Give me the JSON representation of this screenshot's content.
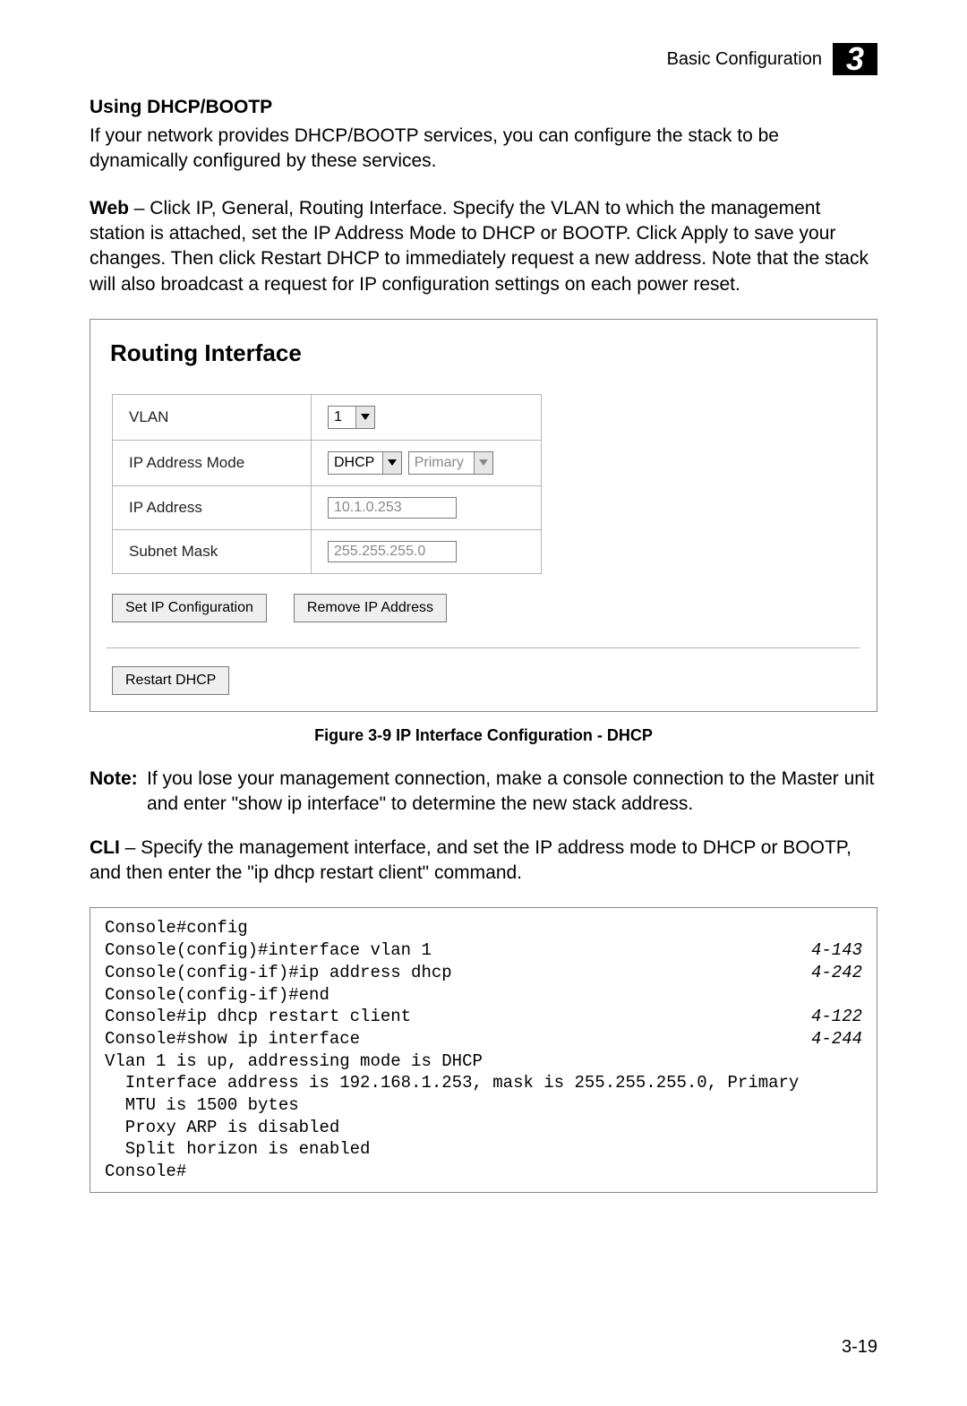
{
  "header": {
    "section": "Basic Configuration",
    "chapter": "3"
  },
  "h_using": "Using DHCP/BOOTP",
  "p_intro": "If your network provides DHCP/BOOTP services, you can configure the stack to be dynamically configured by these services.",
  "p_web_label": "Web",
  "p_web_body": " – Click IP, General, Routing Interface. Specify the VLAN to which the management station is attached, set the IP Address Mode to DHCP or BOOTP. Click Apply to save your changes. Then click Restart DHCP to immediately request a new address. Note that the stack will also broadcast a request for IP configuration settings on each power reset.",
  "panel": {
    "title": "Routing Interface",
    "vlan_label": "VLAN",
    "vlan_value": "1",
    "mode_label": "IP Address Mode",
    "mode_value": "DHCP",
    "mode_type": "Primary",
    "ip_label": "IP Address",
    "ip_value": "10.1.0.253",
    "mask_label": "Subnet Mask",
    "mask_value": "255.255.255.0",
    "btn_set": "Set IP Configuration",
    "btn_remove": "Remove IP Address",
    "btn_restart": "Restart DHCP"
  },
  "figure_caption": "Figure 3-9   IP Interface Configuration - DHCP",
  "note_label": "Note:",
  "note_body": "If you lose your management connection, make a console connection to the Master unit and enter \"show ip interface\" to determine the new stack address.",
  "cli_label": "CLI",
  "cli_body": " – Specify the management interface, and set the IP address mode to DHCP or BOOTP, and then enter the \"ip dhcp restart client\" command.",
  "cli": {
    "l1": "Console#config",
    "l2": "Console(config)#interface vlan 1",
    "r2": "4-143",
    "l3": "Console(config-if)#ip address dhcp",
    "r3": "4-242",
    "l4": "Console(config-if)#end",
    "l5": "Console#ip dhcp restart client",
    "r5": "4-122",
    "l6": "Console#show ip interface",
    "r6": "4-244",
    "l7": "",
    "l8": "Vlan 1 is up, addressing mode is DHCP",
    "l9": "  Interface address is 192.168.1.253, mask is 255.255.255.0, Primary",
    "l10": "  MTU is 1500 bytes",
    "l11": "  Proxy ARP is disabled",
    "l12": "  Split horizon is enabled",
    "l13": "Console#"
  },
  "page_number": "3-19"
}
